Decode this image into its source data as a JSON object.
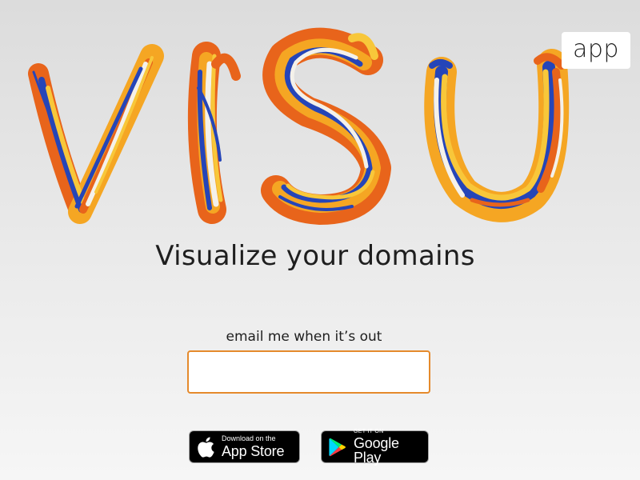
{
  "logo": {
    "letters": "VISU",
    "colors": {
      "orange": "#e8641b",
      "amber": "#f5a623",
      "yellow": "#f8c73a",
      "blue": "#2545b8",
      "white": "#f4f1ea"
    }
  },
  "badge": {
    "label": "app"
  },
  "tagline": "Visualize your domains",
  "signup": {
    "label": "email me when it’s out",
    "value": "",
    "border_color": "#e58a2c"
  },
  "stores": {
    "apple": {
      "small": "Download on the",
      "big": "App Store",
      "icon": "apple-icon"
    },
    "google": {
      "small": "GET IT ON",
      "big": "Google Play",
      "icon": "google-play-icon"
    }
  }
}
